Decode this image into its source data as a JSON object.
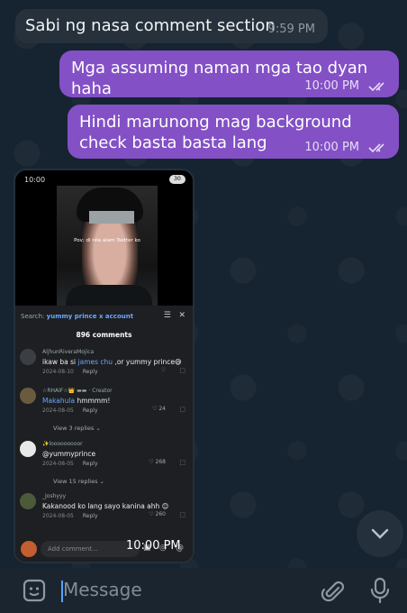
{
  "messages": {
    "incoming": {
      "text": "Sabi ng nasa comment section",
      "time": "9:59 PM"
    },
    "outgoing": [
      {
        "text": "Mga assuming naman mga tao dyan haha",
        "time": "10:00 PM"
      },
      {
        "text": "Hindi marunong mag background check basta basta lang",
        "time": "10:00 PM"
      }
    ],
    "media_time": "10:00 PM"
  },
  "screenshot": {
    "status_time": "10:00",
    "battery": "30",
    "video_caption": "Pov; di nila alam Twitter ko",
    "search_label": "Search:",
    "search_query": "yummy prince x account",
    "comment_count": "896 comments",
    "comments": [
      {
        "user": "AljhunRiveraMojica",
        "pre": "ikaw ba si ",
        "mention": "james chu",
        "post": " ,or yummy prince😅",
        "date": "2024-08-10",
        "reply": "Reply",
        "likes": ""
      },
      {
        "user": "☆RHAIF☆👑 ▬▬ · Creator",
        "pre": "",
        "mention": "Makahula",
        "post": " hmmmm!",
        "date": "2024-08-05",
        "reply": "Reply",
        "likes": "24",
        "replies": "View 3 replies ⌄"
      },
      {
        "user": "✨looooooooor",
        "pre": "@yummyprince",
        "mention": "",
        "post": "",
        "date": "2024-08-05",
        "reply": "Reply",
        "likes": "268",
        "replies": "View 15 replies ⌄"
      },
      {
        "user": "_Joshyyy",
        "pre": "Kakanood ko lang sayo kanina ahh 😊",
        "mention": "",
        "post": "",
        "date": "2024-08-05",
        "reply": "Reply",
        "likes": "260"
      }
    ],
    "add_comment_placeholder": "Add comment..."
  },
  "input": {
    "placeholder": "Message"
  },
  "colors": {
    "outgoing_bubble": "#8350c6",
    "incoming_bubble": "#26313c",
    "background": "#162330"
  }
}
